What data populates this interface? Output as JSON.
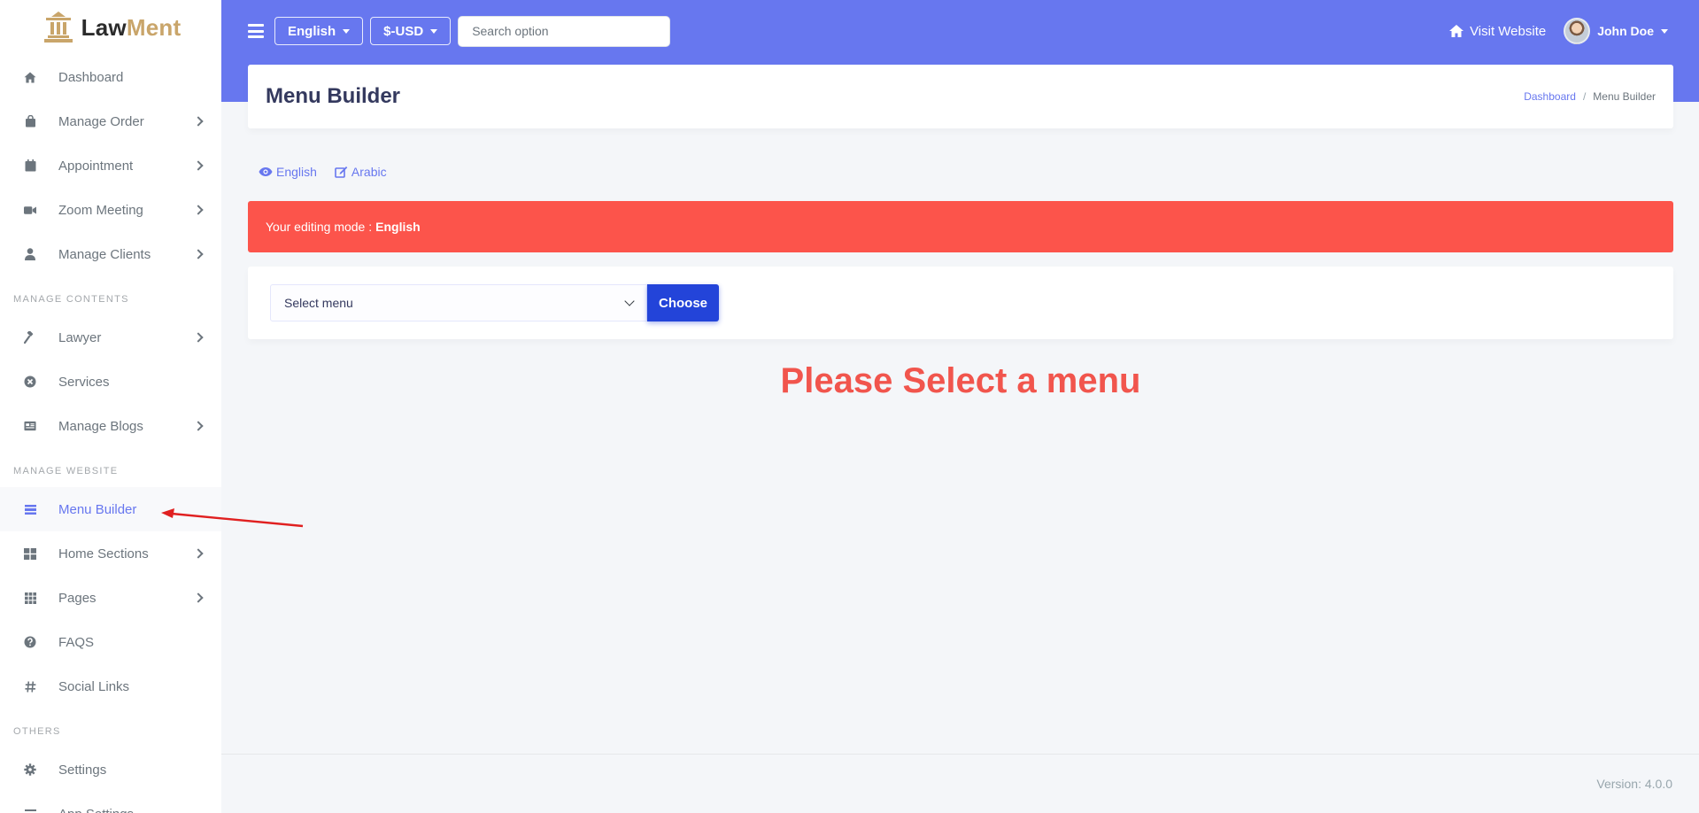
{
  "brand": {
    "name_part1": "Law",
    "name_part2": "Ment"
  },
  "sidebar": {
    "items_main": [
      {
        "label": "Dashboard",
        "icon": "home-icon",
        "chevron": false
      },
      {
        "label": "Manage Order",
        "icon": "shopping-bag-icon",
        "chevron": true
      },
      {
        "label": "Appointment",
        "icon": "calendar-icon",
        "chevron": true
      },
      {
        "label": "Zoom Meeting",
        "icon": "video-icon",
        "chevron": true
      },
      {
        "label": "Manage Clients",
        "icon": "user-icon",
        "chevron": true
      }
    ],
    "header_contents": "MANAGE CONTENTS",
    "items_contents": [
      {
        "label": "Lawyer",
        "icon": "gavel-icon",
        "chevron": true
      },
      {
        "label": "Services",
        "icon": "circle-x-icon",
        "chevron": false
      },
      {
        "label": "Manage Blogs",
        "icon": "newspaper-icon",
        "chevron": true
      }
    ],
    "header_website": "MANAGE WEBSITE",
    "items_website": [
      {
        "label": "Menu Builder",
        "icon": "bars-icon",
        "chevron": false,
        "active": true
      },
      {
        "label": "Home Sections",
        "icon": "th-large-icon",
        "chevron": true
      },
      {
        "label": "Pages",
        "icon": "grid-icon",
        "chevron": true
      },
      {
        "label": "FAQS",
        "icon": "question-circle-icon",
        "chevron": false
      },
      {
        "label": "Social Links",
        "icon": "hashtag-icon",
        "chevron": false
      }
    ],
    "header_others": "OTHERS",
    "items_others": [
      {
        "label": "Settings",
        "icon": "cog-icon",
        "chevron": false
      },
      {
        "label": "App Settings",
        "icon": "bars-icon",
        "chevron": false
      }
    ]
  },
  "topbar": {
    "language": "English",
    "currency": "$-USD",
    "search_placeholder": "Search option",
    "visit_website": "Visit Website",
    "user_name": "John Doe"
  },
  "header": {
    "title": "Menu Builder",
    "breadcrumb_home": "Dashboard",
    "breadcrumb_sep": "/",
    "breadcrumb_current": "Menu Builder"
  },
  "lang_tabs": [
    {
      "label": "English",
      "icon": "eye-icon"
    },
    {
      "label": "Arabic",
      "icon": "edit-icon"
    }
  ],
  "alert": {
    "prefix": "Your editing mode :",
    "language": "English"
  },
  "menu_select": {
    "value": "Select menu",
    "button": "Choose"
  },
  "empty_message": "Please Select a menu",
  "footer": {
    "version": "Version: 4.0.0"
  },
  "colors": {
    "primary": "#6777ef",
    "danger": "#fc544b",
    "button": "#2344d9",
    "brand_gold": "#c9a56a"
  }
}
